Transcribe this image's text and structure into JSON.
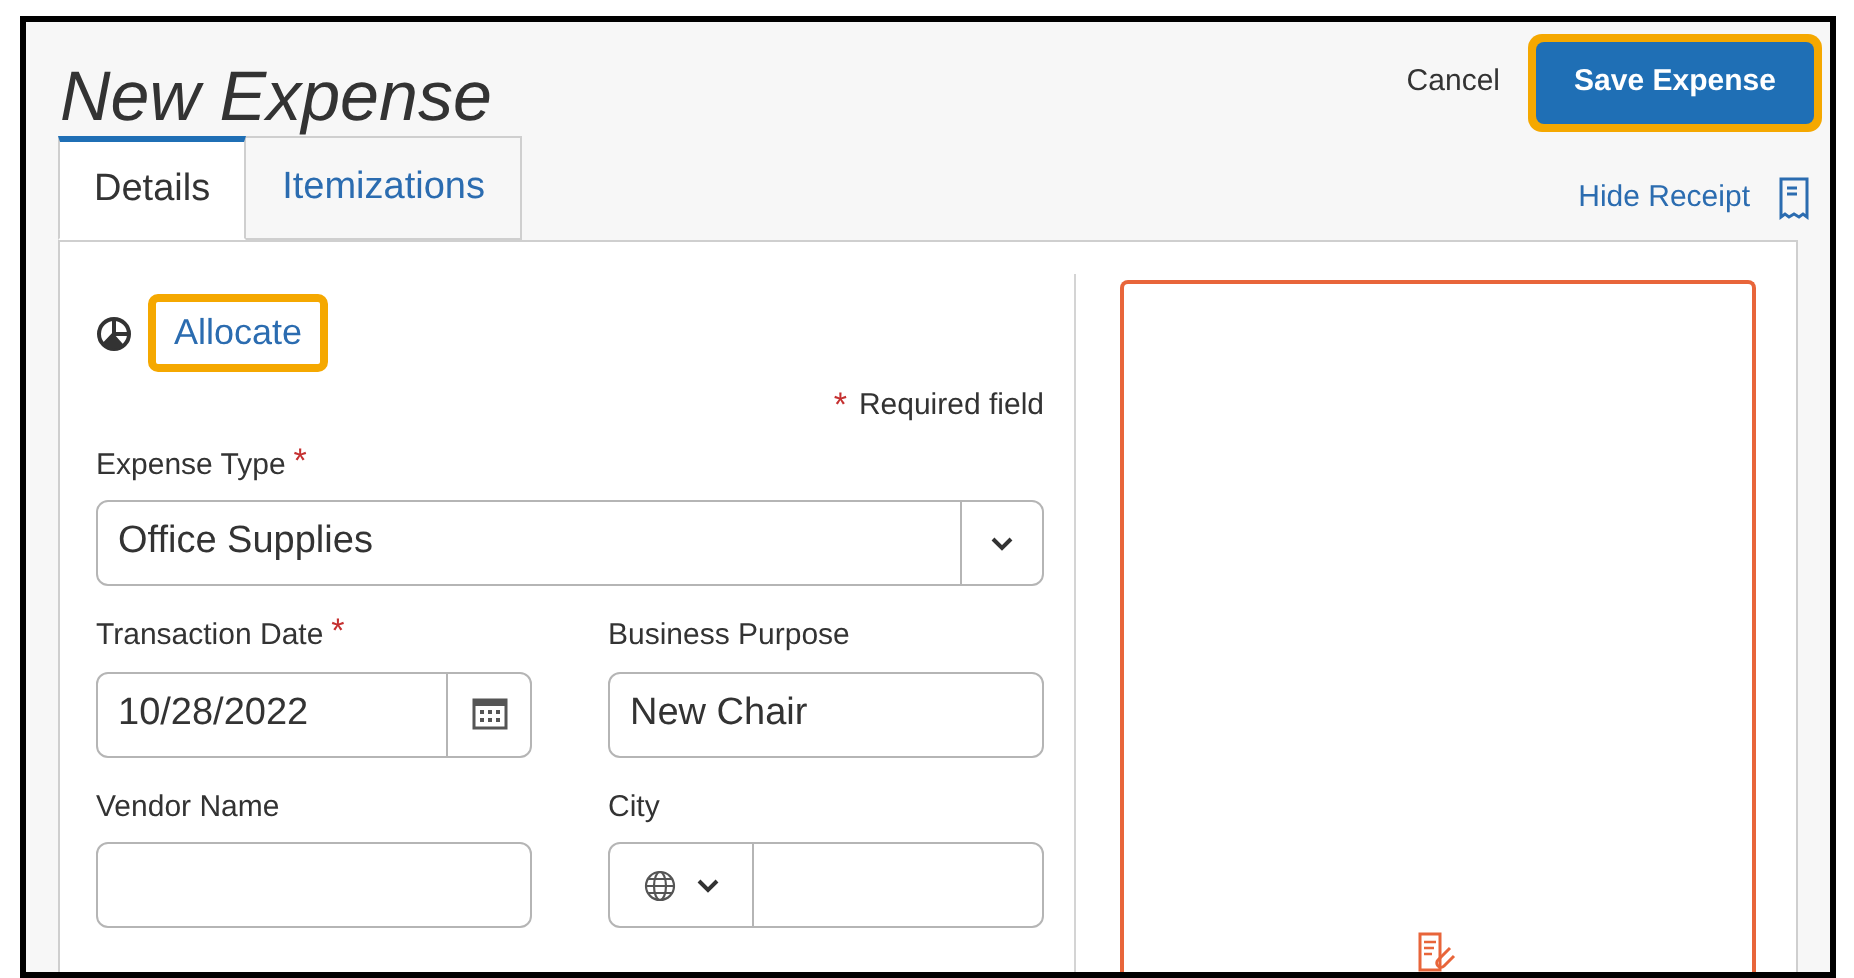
{
  "title": "New Expense",
  "actions": [
    {
      "kind": "link",
      "label": "Cancel",
      "highlighted": false
    },
    {
      "kind": "primary",
      "label": "Save Expense",
      "highlighted": true
    }
  ],
  "tabs": [
    {
      "label": "Details",
      "selected": true
    },
    {
      "label": "Itemizations",
      "selected": false
    }
  ],
  "hide_receipt": {
    "label": "Hide Receipt"
  },
  "allocate": {
    "label": "Allocate",
    "highlighted": true
  },
  "required_note": {
    "mark": "*",
    "text": "Required field"
  },
  "form_rows": [
    [
      {
        "kind": "select",
        "label": "Expense Type",
        "required": true,
        "value": "Office Supplies"
      }
    ],
    [
      {
        "kind": "date",
        "label": "Transaction Date",
        "required": true,
        "value": "10/28/2022"
      },
      {
        "kind": "text",
        "label": "Business Purpose",
        "required": false,
        "value": "New Chair"
      }
    ],
    [
      {
        "kind": "text",
        "label": "Vendor Name",
        "required": false
      },
      {
        "kind": "city",
        "label": "City",
        "required": false
      }
    ]
  ]
}
